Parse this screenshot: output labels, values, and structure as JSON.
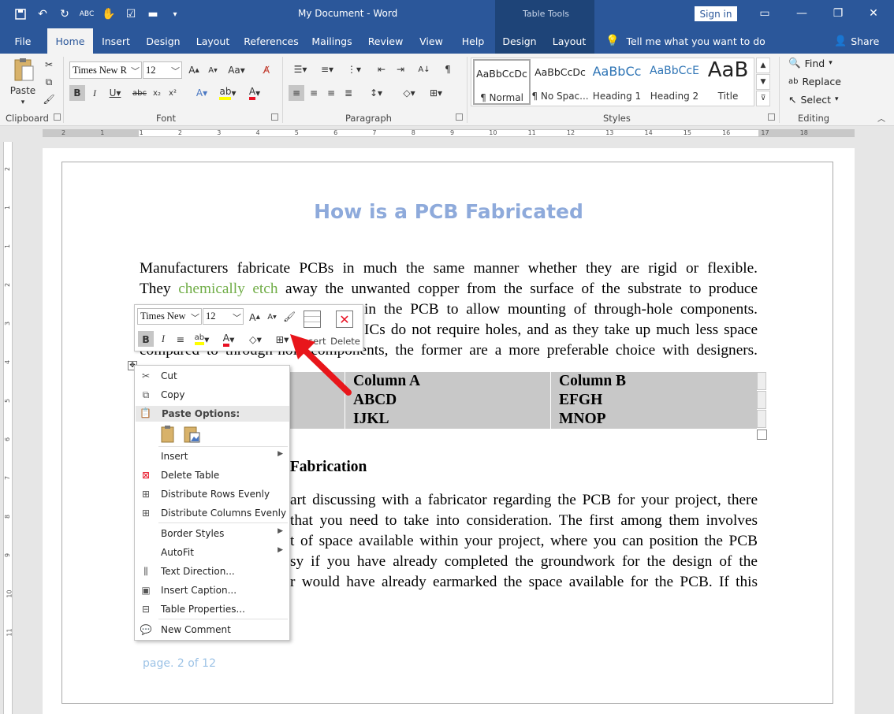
{
  "window": {
    "doc_title": "My Document  -  Word",
    "table_tools": "Table Tools",
    "sign_in": "Sign in"
  },
  "tabs": [
    "File",
    "Home",
    "Insert",
    "Design",
    "Layout",
    "References",
    "Mailings",
    "Review",
    "View",
    "Help",
    "Design",
    "Layout"
  ],
  "tell_me": "Tell me what you want to do",
  "share": "Share",
  "ribbon": {
    "paste": "Paste",
    "clipboard": "Clipboard",
    "font": "Font",
    "font_name": "Times New R",
    "font_size": "12",
    "paragraph": "Paragraph",
    "styles": "Styles",
    "editing": "Editing",
    "style_cards": [
      {
        "sample": "AaBbCcDc",
        "name": "¶ Normal"
      },
      {
        "sample": "AaBbCcDc",
        "name": "¶ No Spac..."
      },
      {
        "sample": "AaBbCc",
        "name": "Heading 1"
      },
      {
        "sample": "AaBbCcE",
        "name": "Heading 2"
      },
      {
        "sample": "AaB",
        "name": "Title"
      }
    ],
    "find": "Find",
    "replace": "Replace",
    "select": "Select"
  },
  "ruler": {
    "top_numbers": [
      "2",
      "1",
      "1",
      "2",
      "3",
      "4",
      "5",
      "6",
      "7",
      "8",
      "9",
      "10",
      "11",
      "12",
      "13",
      "14",
      "15",
      "16",
      "17",
      "18"
    ],
    "left_numbers": [
      "2",
      "1",
      "1",
      "2",
      "3",
      "4",
      "5",
      "6",
      "7",
      "8",
      "9",
      "10",
      "11"
    ]
  },
  "document": {
    "heading": "How is a PCB Fabricated",
    "para1": [
      {
        "text": "Manufacturers fabricate PCBs in much the same manner whether they are rigid or flexible."
      },
      {
        "pre": "They ",
        "green": "chemically etch",
        "post": " away the unwanted copper from the surface of the substrate to produce"
      },
      {
        "text": "in the PCB to allow mounting of through-hole components."
      },
      {
        "text": "ICs do not require holes, and as they take up much less space"
      },
      {
        "text": "compared to through-hole components, the former are a more preferable choice with designers."
      }
    ],
    "table": {
      "col_a": [
        "Column A",
        "ABCD",
        "IJKL"
      ],
      "col_b": [
        "Column B",
        "EFGH",
        "MNOP"
      ]
    },
    "section_heading": "B Fabrication",
    "para2": [
      "art discussing with a fabricator regarding the PCB for your project, there",
      "that you need to take into consideration. The first among them involves",
      "t of space available within your project, where you can position the PCB",
      "sy if you have already completed the groundwork for the design of the",
      "r would have already earmarked the space available for the PCB. If this"
    ],
    "footer": "page. 2 of 12"
  },
  "mini_toolbar": {
    "font_name": "Times New",
    "font_size": "12",
    "insert": "Insert",
    "delete": "Delete"
  },
  "context_menu": {
    "cut": "Cut",
    "copy": "Copy",
    "paste_options": "Paste Options:",
    "insert": "Insert",
    "delete_table": "Delete Table",
    "distribute_rows": "Distribute Rows Evenly",
    "distribute_cols": "Distribute Columns Evenly",
    "border_styles": "Border Styles",
    "autofit": "AutoFit",
    "text_direction": "Text Direction...",
    "insert_caption": "Insert Caption...",
    "table_properties": "Table Properties...",
    "new_comment": "New Comment"
  },
  "colors": {
    "brand": "#2b579a",
    "heading": "#8eaadb",
    "green": "#70ad47",
    "arrow": "#e8161b"
  }
}
